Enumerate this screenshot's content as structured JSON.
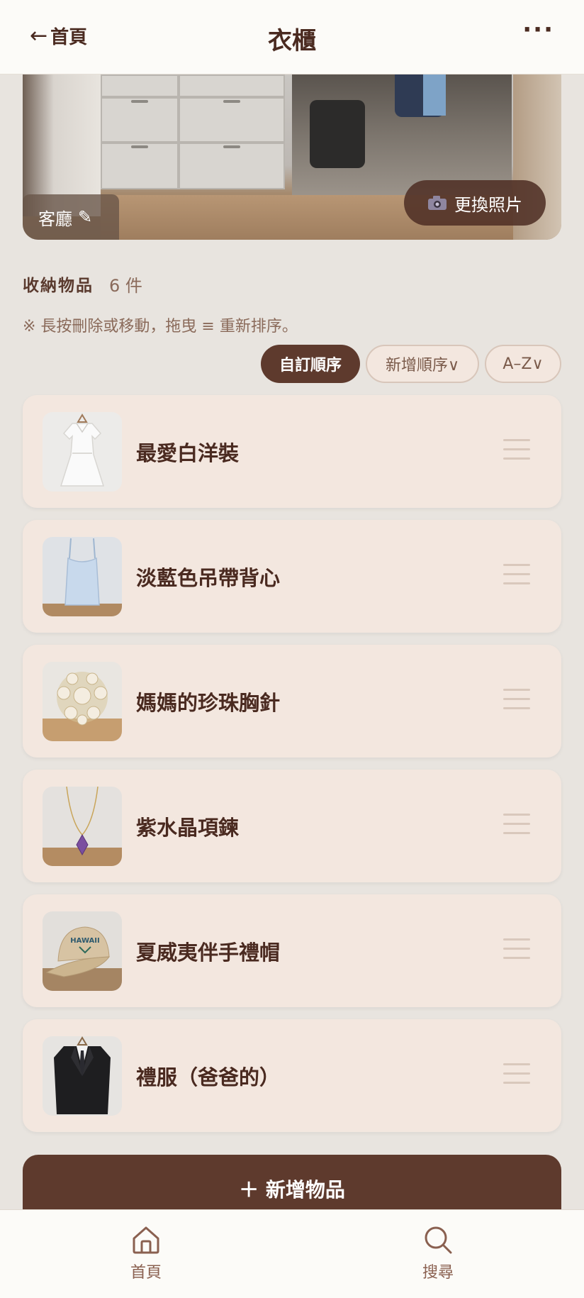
{
  "header": {
    "back_label": "首頁",
    "back_arrow": "←",
    "title": "衣櫃",
    "more": "···"
  },
  "cover": {
    "location_label": "客廳",
    "edit_icon": "✎",
    "change_photo_icon": "camera-icon",
    "change_photo_label": "更換照片"
  },
  "section": {
    "title": "收納物品",
    "count": "6 件",
    "hint": "※ 長按刪除或移動，拖曳 ≡ 重新排序。"
  },
  "sort": {
    "options": [
      {
        "label": "自訂順序",
        "active": true
      },
      {
        "label": "新增順序∨",
        "active": false
      },
      {
        "label": "A–Z∨",
        "active": false
      }
    ]
  },
  "items": [
    {
      "name": "最愛白洋裝",
      "thumb": "white-dress"
    },
    {
      "name": "淡藍色吊帶背心",
      "thumb": "blue-camisole"
    },
    {
      "name": "媽媽的珍珠胸針",
      "thumb": "pearl-brooch"
    },
    {
      "name": "紫水晶項鍊",
      "thumb": "amethyst-necklace"
    },
    {
      "name": "夏威夷伴手禮帽",
      "thumb": "hawaii-cap",
      "thumb_text": "HAWAII"
    },
    {
      "name": "禮服（爸爸的）",
      "thumb": "black-suit"
    }
  ],
  "add_button": {
    "label": "＋ 新增物品"
  },
  "nav": {
    "home_label": "首頁",
    "search_label": "搜尋"
  },
  "colors": {
    "primary": "#5e3a2d",
    "card": "#f3e7df",
    "background": "#e8e4df"
  }
}
